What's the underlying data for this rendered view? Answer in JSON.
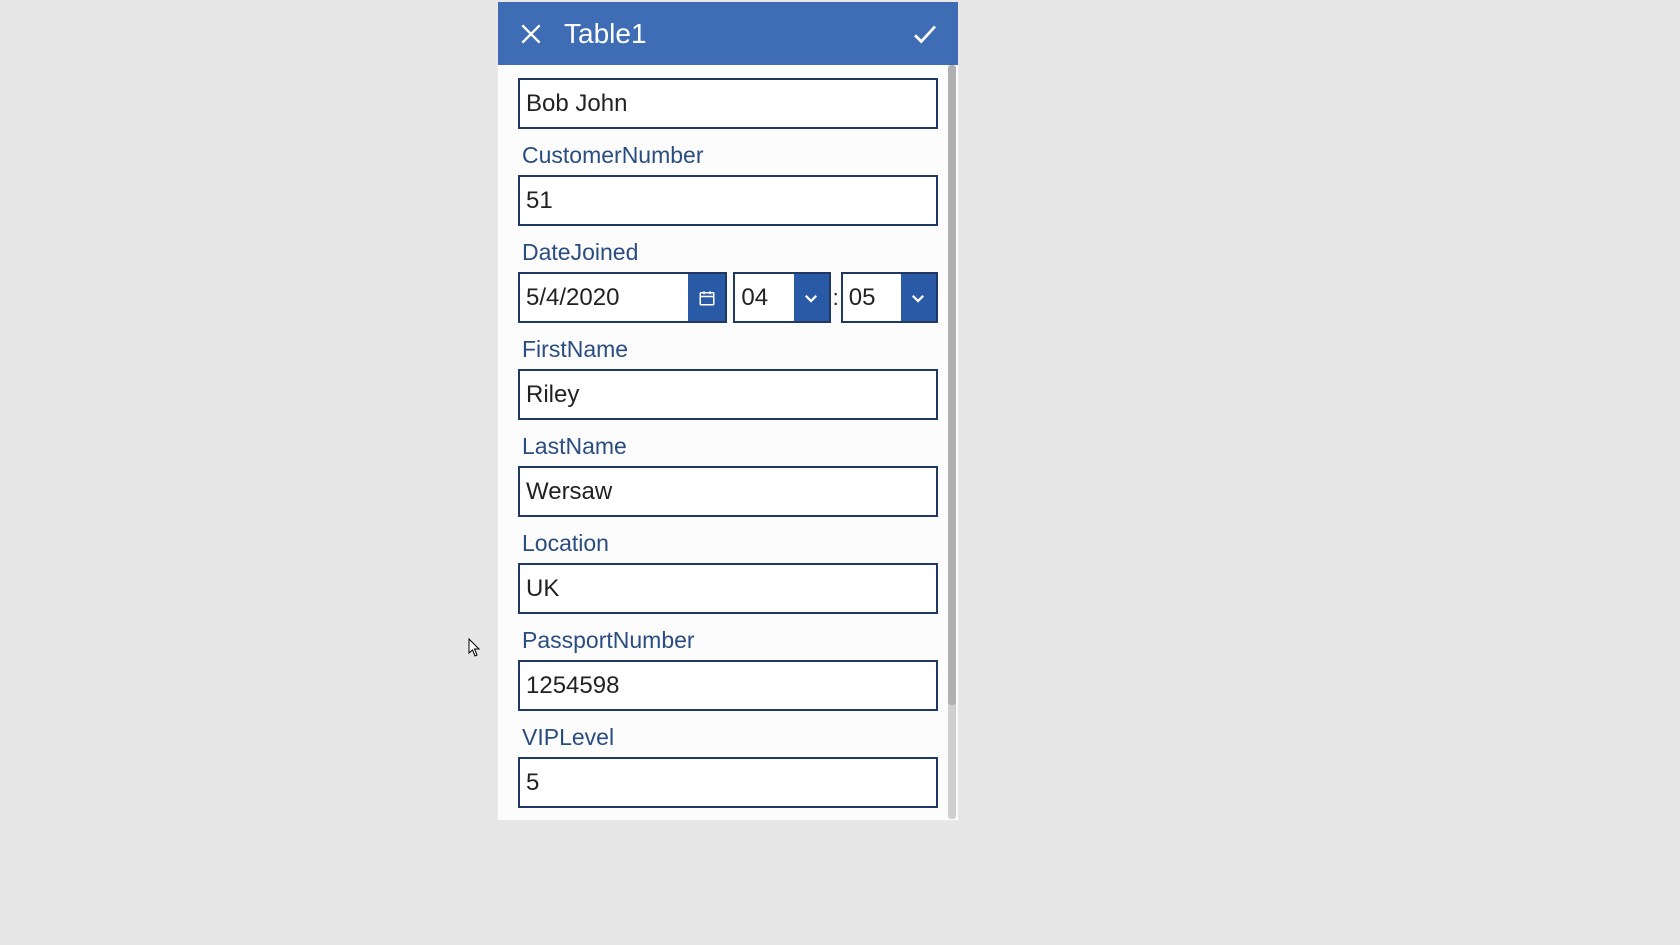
{
  "header": {
    "title": "Table1"
  },
  "fields": {
    "topClipped": {
      "value": "Bob John"
    },
    "customerNumber": {
      "label": "CustomerNumber",
      "value": "51"
    },
    "dateJoined": {
      "label": "DateJoined",
      "date": "5/4/2020",
      "hour": "04",
      "minute": "05",
      "separator": ":"
    },
    "firstName": {
      "label": "FirstName",
      "value": "Riley"
    },
    "lastName": {
      "label": "LastName",
      "value": "Wersaw"
    },
    "location": {
      "label": "Location",
      "value": "UK"
    },
    "passportNumber": {
      "label": "PassportNumber",
      "value": "1254598"
    },
    "vipLevel": {
      "label": "VIPLevel",
      "value": "5"
    }
  }
}
